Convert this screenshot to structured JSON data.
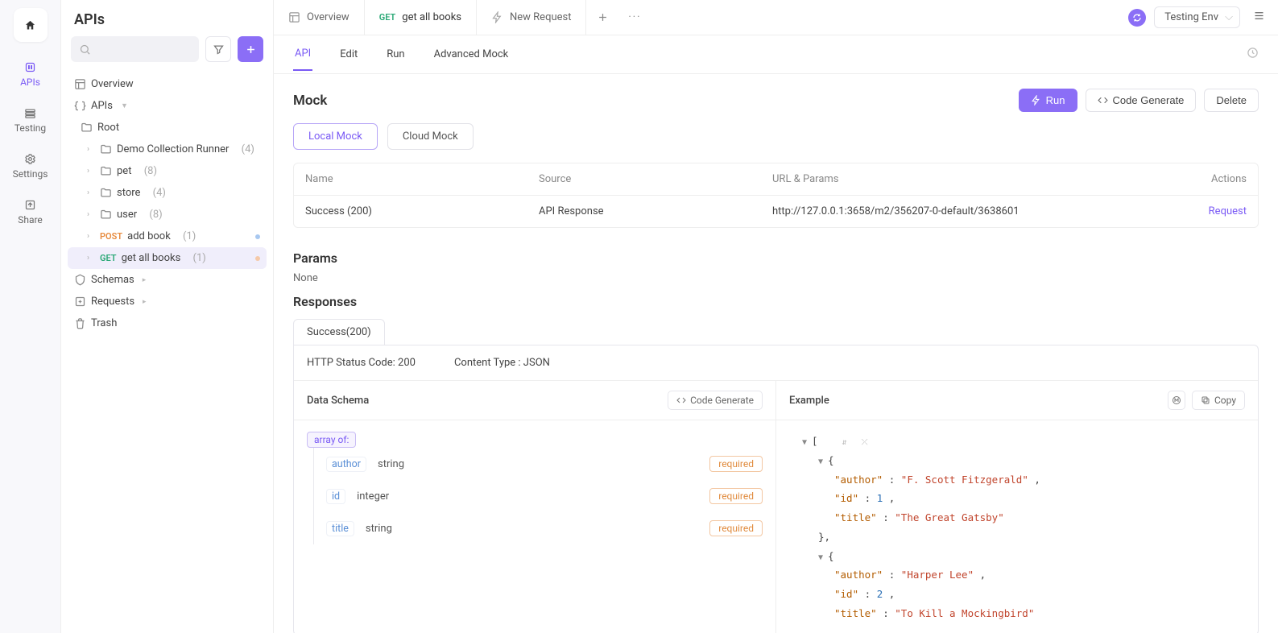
{
  "rail": {
    "apis": "APIs",
    "testing": "Testing",
    "settings": "Settings",
    "share": "Share"
  },
  "sidebar": {
    "title": "APIs",
    "overview": "Overview",
    "apis_label": "APIs",
    "root": "Root",
    "items": [
      {
        "label": "Demo Collection Runner",
        "count": "(4)"
      },
      {
        "label": "pet",
        "count": "(8)"
      },
      {
        "label": "store",
        "count": "(4)"
      },
      {
        "label": "user",
        "count": "(8)"
      }
    ],
    "endpoints": [
      {
        "method": "POST",
        "label": "add book",
        "count": "(1)"
      },
      {
        "method": "GET",
        "label": "get all books",
        "count": "(1)"
      }
    ],
    "schemas": "Schemas",
    "requests": "Requests",
    "trash": "Trash"
  },
  "tabs": {
    "overview": "Overview",
    "active_method": "GET",
    "active_label": "get all books",
    "new_request": "New Request"
  },
  "env": {
    "label": "Testing Env"
  },
  "subtabs": {
    "api": "API",
    "edit": "Edit",
    "run": "Run",
    "advanced_mock": "Advanced Mock"
  },
  "mock": {
    "title": "Mock",
    "run_btn": "Run",
    "codegen_btn": "Code Generate",
    "delete_btn": "Delete",
    "local_tab": "Local Mock",
    "cloud_tab": "Cloud Mock",
    "table": {
      "h_name": "Name",
      "h_source": "Source",
      "h_url": "URL & Params",
      "h_actions": "Actions",
      "row": {
        "name": "Success (200)",
        "source": "API Response",
        "url": "http://127.0.0.1:3658/m2/356207-0-default/3638601",
        "action": "Request"
      }
    }
  },
  "params": {
    "title": "Params",
    "value": "None"
  },
  "responses": {
    "title": "Responses",
    "tab": "Success(200)",
    "status_label": "HTTP Status Code: ",
    "status_value": "200",
    "ct_label": "Content Type : ",
    "ct_value": "JSON",
    "schema_title": "Data Schema",
    "schema_codegen": "Code Generate",
    "array_of": "array of:",
    "fields": [
      {
        "name": "author",
        "type": "string",
        "req": "required"
      },
      {
        "name": "id",
        "type": "integer",
        "req": "required"
      },
      {
        "name": "title",
        "type": "string",
        "req": "required"
      }
    ],
    "example_title": "Example",
    "copy_label": "Copy",
    "example": [
      {
        "author": "F. Scott Fitzgerald",
        "id": 1,
        "title": "The Great Gatsby"
      },
      {
        "author": "Harper Lee",
        "id": 2,
        "title": "To Kill a Mockingbird"
      }
    ]
  }
}
